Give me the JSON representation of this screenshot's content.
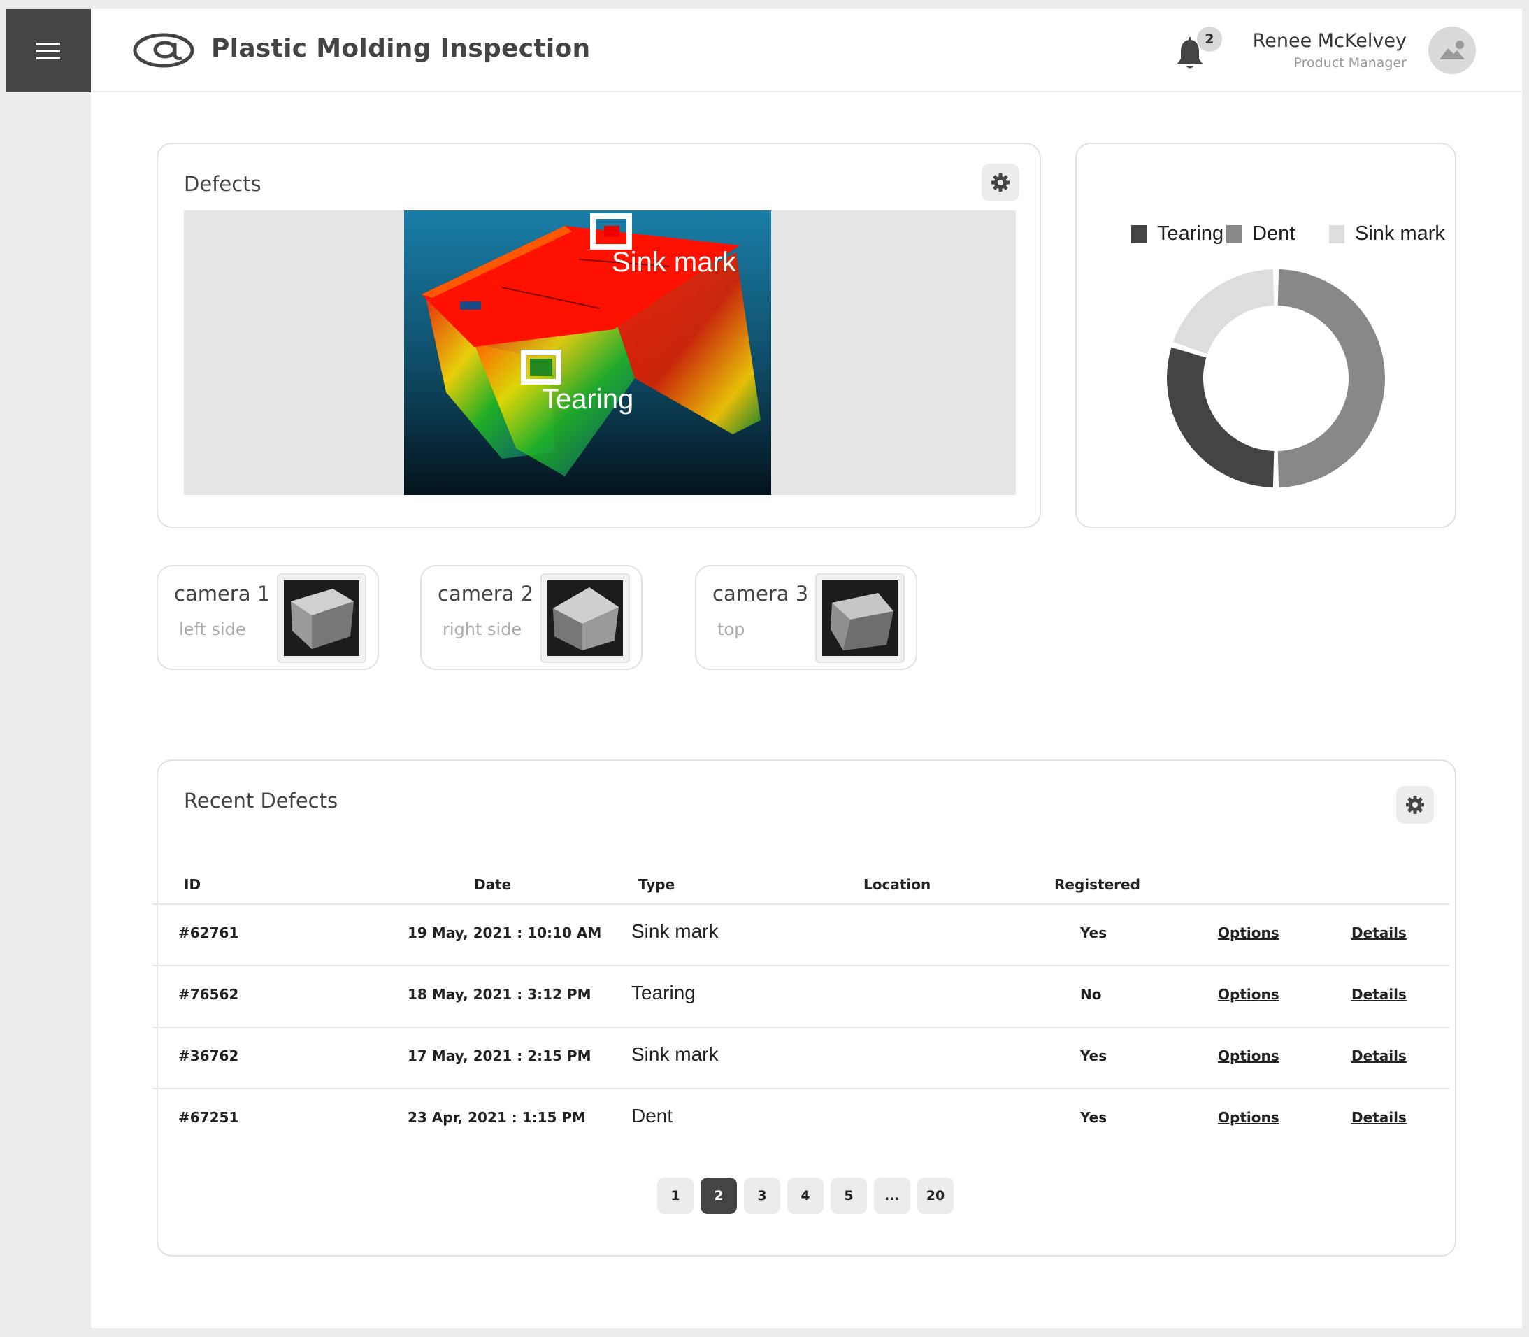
{
  "app": {
    "title": "Plastic Molding Inspection",
    "notifications_count": "2",
    "user_name": "Renee McKelvey",
    "user_role": "Product Manager"
  },
  "defects_card": {
    "title": "Defects",
    "annotations": [
      "Sink mark",
      "Tearing"
    ]
  },
  "chart_data": {
    "type": "pie",
    "categories": [
      "Tearing",
      "Dent",
      "Sink mark"
    ],
    "values": [
      30,
      50,
      20
    ],
    "colors": [
      "#444444",
      "#888888",
      "#dddddd"
    ],
    "legend_position": "top"
  },
  "cameras": [
    {
      "title": "camera 1",
      "subtitle": "left side"
    },
    {
      "title": "camera 2",
      "subtitle": "right side"
    },
    {
      "title": "camera 3",
      "subtitle": "top"
    }
  ],
  "recent_defects": {
    "title": "Recent Defects",
    "columns": [
      "ID",
      "Date",
      "Type",
      "Location",
      "Registered"
    ],
    "rows": [
      {
        "id": "#62761",
        "date": "19 May, 2021 : 10:10 AM",
        "type": "Sink mark",
        "location": "",
        "registered": "Yes",
        "options": "Options",
        "details": "Details"
      },
      {
        "id": "#76562",
        "date": "18 May, 2021 : 3:12 PM",
        "type": "Tearing",
        "location": "",
        "registered": "No",
        "options": "Options",
        "details": "Details"
      },
      {
        "id": "#36762",
        "date": "17 May, 2021 : 2:15 PM",
        "type": "Sink mark",
        "location": "",
        "registered": "Yes",
        "options": "Options",
        "details": "Details"
      },
      {
        "id": "#67251",
        "date": "23 Apr, 2021 : 1:15 PM",
        "type": "Dent",
        "location": "",
        "registered": "Yes",
        "options": "Options",
        "details": "Details"
      }
    ]
  },
  "pagination": {
    "pages": [
      "1",
      "2",
      "3",
      "4",
      "5",
      "...",
      "20"
    ],
    "current": "2"
  },
  "icons": {
    "menu": "hamburger-icon",
    "logo": "at-sign-logo",
    "notifications": "bell-icon",
    "avatar": "user-avatar-icon",
    "settings": "gear-icon"
  }
}
